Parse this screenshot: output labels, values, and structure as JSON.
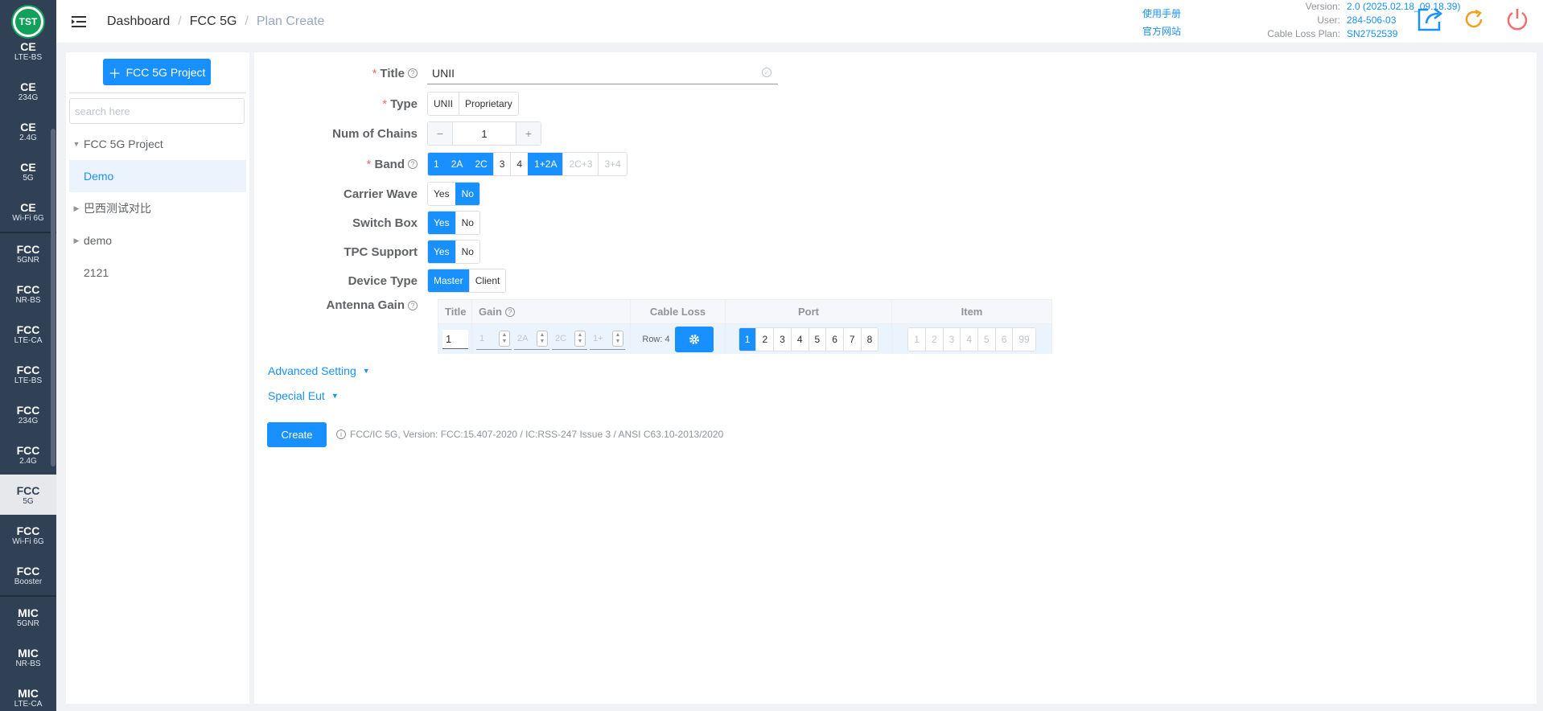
{
  "logo": {
    "text": "TST"
  },
  "nav": [
    {
      "a": "CE",
      "b": "LTE-BS"
    },
    {
      "a": "CE",
      "b": "234G"
    },
    {
      "a": "CE",
      "b": "2.4G"
    },
    {
      "a": "CE",
      "b": "5G"
    },
    {
      "a": "CE",
      "b": "Wi-Fi 6G"
    },
    {
      "a": "FCC",
      "b": "5GNR"
    },
    {
      "a": "FCC",
      "b": "NR-BS"
    },
    {
      "a": "FCC",
      "b": "LTE-CA"
    },
    {
      "a": "FCC",
      "b": "LTE-BS"
    },
    {
      "a": "FCC",
      "b": "234G"
    },
    {
      "a": "FCC",
      "b": "2.4G"
    },
    {
      "a": "FCC",
      "b": "5G"
    },
    {
      "a": "FCC",
      "b": "Wi-Fi 6G"
    },
    {
      "a": "FCC",
      "b": "Booster"
    },
    {
      "a": "MIC",
      "b": "5GNR"
    },
    {
      "a": "MIC",
      "b": "NR-BS"
    },
    {
      "a": "MIC",
      "b": "LTE-CA"
    }
  ],
  "breadcrumb": {
    "dashboard": "Dashboard",
    "section": "FCC 5G",
    "current": "Plan Create",
    "sep": "/"
  },
  "header_links": {
    "manual": "使用手册",
    "website": "官方网站"
  },
  "info": {
    "version_label": "Version:",
    "version": "2.0 (2025.02.18_09.18.39)",
    "user_label": "User:",
    "user": "284-506-03",
    "cable_label": "Cable Loss Plan:",
    "cable": "SN2752539"
  },
  "left": {
    "add_button": "FCC 5G Project",
    "search_placeholder": "search here",
    "tree": [
      {
        "label": "FCC 5G Project",
        "arrow": "▼"
      },
      {
        "label": "Demo",
        "arrow": ""
      },
      {
        "label": "巴西测试对比",
        "arrow": "▶"
      },
      {
        "label": "demo",
        "arrow": "▶"
      },
      {
        "label": "2121",
        "arrow": ""
      }
    ]
  },
  "form": {
    "req": "*",
    "title_label": "Title",
    "title_value": "UNII",
    "type_label": "Type",
    "type_options": [
      "UNII",
      "Proprietary"
    ],
    "chains_label": "Num of Chains",
    "chains_value": "1",
    "minus": "−",
    "plus": "+",
    "band_label": "Band",
    "band_options": [
      "1",
      "2A",
      "2C",
      "3",
      "4",
      "1+2A",
      "2C+3",
      "3+4"
    ],
    "cw_label": "Carrier Wave",
    "cw_options": [
      "Yes",
      "No"
    ],
    "sb_label": "Switch Box",
    "sb_options": [
      "Yes",
      "No"
    ],
    "tpc_label": "TPC Support",
    "tpc_options": [
      "Yes",
      "No"
    ],
    "dt_label": "Device Type",
    "dt_options": [
      "Master",
      "Client"
    ],
    "ag_label": "Antenna Gain",
    "qmark": "?"
  },
  "gain_table": {
    "headers": {
      "title": "Title",
      "gain": "Gain",
      "cable": "Cable Loss",
      "port": "Port",
      "item": "Item"
    },
    "title_value": "1",
    "gain_placeholders": [
      "1",
      "2A",
      "2C",
      "1+"
    ],
    "row_text": "Row: 4",
    "ports": [
      "1",
      "2",
      "3",
      "4",
      "5",
      "6",
      "7",
      "8"
    ],
    "items": [
      "1",
      "2",
      "3",
      "4",
      "5",
      "6",
      "99"
    ]
  },
  "advanced": "Advanced Setting",
  "special": "Special Eut",
  "create_button": "Create",
  "footer_note": "FCC/IC 5G, Version: FCC:15.407-2020 / IC:RSS-247 Issue 3 / ANSI C63.10-2013/2020",
  "colors": {
    "primary": "#1890ff",
    "sidebar": "#304156",
    "logo": "#12a05a"
  }
}
